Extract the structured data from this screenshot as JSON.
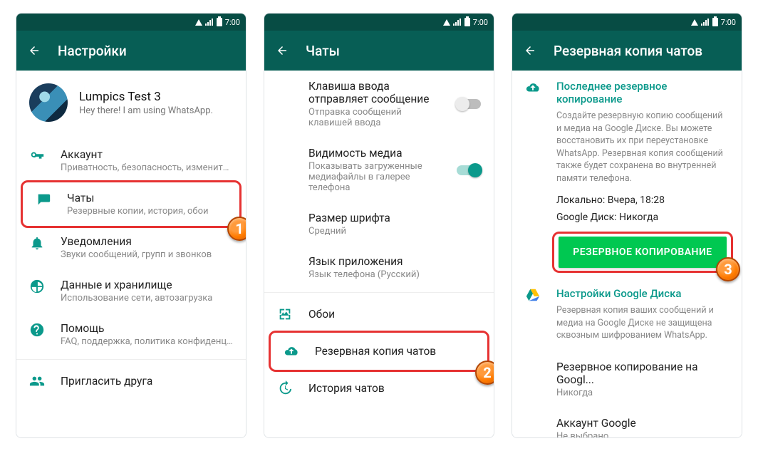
{
  "status": {
    "time": "7:00"
  },
  "screens": {
    "settings": {
      "title": "Настройки",
      "profile": {
        "name": "Lumpics Test 3",
        "status": "Hey there! I am using WhatsApp."
      },
      "items": {
        "account": {
          "title": "Аккаунт",
          "sub": "Приватность, безопасность, изменить но..."
        },
        "chats": {
          "title": "Чаты",
          "sub": "Резервные копии, история, обои"
        },
        "notif": {
          "title": "Уведомления",
          "sub": "Звуки сообщений, групп и звонков"
        },
        "data": {
          "title": "Данные и хранилище",
          "sub": "Использование сети, автозагрузка"
        },
        "help": {
          "title": "Помощь",
          "sub": "FAQ, поддержка, политика конфиденциал..."
        },
        "invite": {
          "title": "Пригласить друга"
        }
      },
      "badge": "1"
    },
    "chats": {
      "title": "Чаты",
      "items": {
        "enter": {
          "title": "Клавиша ввода отправляет сообщение",
          "sub": "Отправка сообщений клавишей ввода"
        },
        "media": {
          "title": "Видимость медиа",
          "sub": "Показывать загруженные медиафайлы в галерее телефона"
        },
        "font": {
          "title": "Размер шрифта",
          "sub": "Средний"
        },
        "lang": {
          "title": "Язык приложения",
          "sub": "Язык телефона  (Русский)"
        },
        "wall": {
          "title": "Обои"
        },
        "backup": {
          "title": "Резервная копия чатов"
        },
        "hist": {
          "title": "История чатов"
        }
      },
      "badge": "2"
    },
    "backup": {
      "title": "Резервная копия чатов",
      "last": {
        "heading": "Последнее резервное копирование",
        "desc": "Создайте резервную копию сообщений и медиа на Google Диске. Вы можете восстановить их при переустановке WhatsApp. Резервная копия сообщений также будет сохранена во внутренней памяти телефона.",
        "local_label": "Локально:",
        "local_value": "Вчера, 18:28",
        "drive_label": "Google Диск:",
        "drive_value": "Никогда",
        "button": "РЕЗЕРВНОЕ КОПИРОВАНИЕ"
      },
      "gdrive": {
        "heading": "Настройки Google Диска",
        "desc": "Резервная копия ваших сообщений и медиа на Google Диске не защищена сквозным шифрованием WhatsApp.",
        "freq_title": "Резервное копирование на Googl...",
        "freq_value": "Никогда",
        "acct_title": "Аккаунт Google",
        "acct_value": "Не выбрано"
      },
      "badge": "3"
    }
  }
}
